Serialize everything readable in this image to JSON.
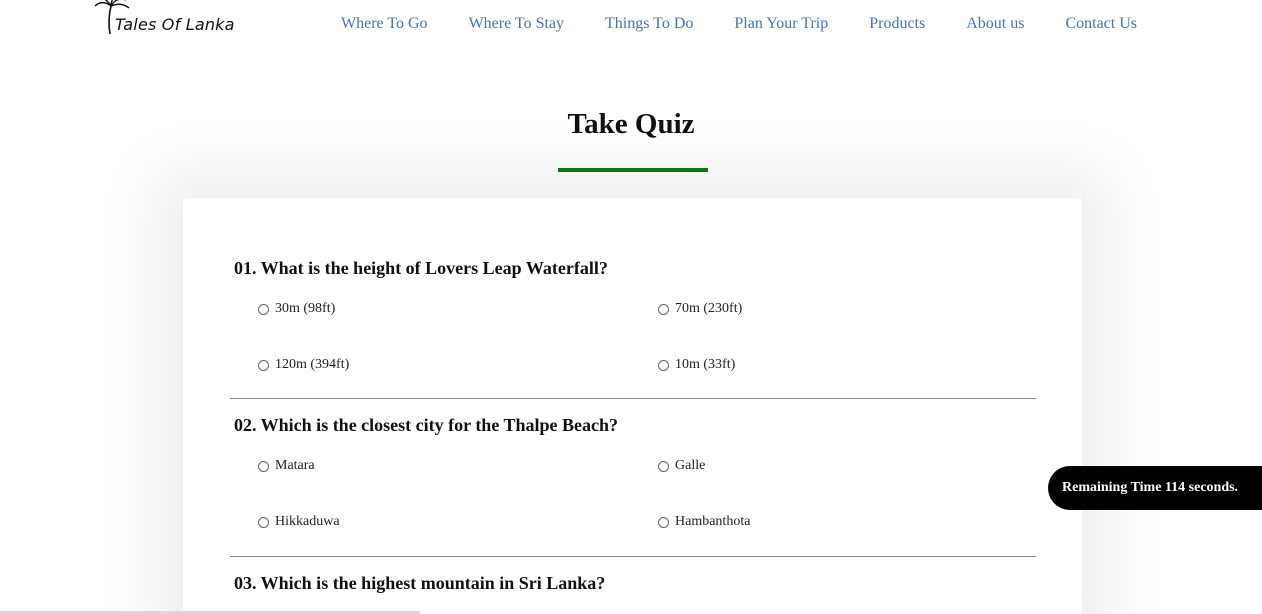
{
  "brand": {
    "name": "Tales Of Lanka",
    "icon": "palm-tree-icon"
  },
  "nav": {
    "items": [
      "Where To Go",
      "Where To Stay",
      "Things To Do",
      "Plan Your Trip",
      "Products",
      "About us",
      "Contact Us"
    ]
  },
  "page": {
    "title": "Take Quiz",
    "accent_color": "#0f7a12"
  },
  "quiz": {
    "questions": [
      {
        "text": "01. What is the height of Lovers Leap Waterfall?",
        "options": [
          "30m (98ft)",
          "70m (230ft)",
          "120m (394ft)",
          "10m (33ft)"
        ]
      },
      {
        "text": "02. Which is the closest city for the Thalpe Beach?",
        "options": [
          "Matara",
          "Galle",
          "Hikkaduwa",
          "Hambanthota"
        ]
      },
      {
        "text": "03. Which is the highest mountain in Sri Lanka?",
        "options": []
      }
    ]
  },
  "timer": {
    "text": "Remaining Time 114 seconds."
  }
}
